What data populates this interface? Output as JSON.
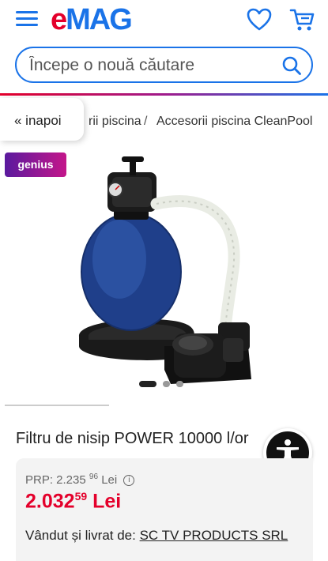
{
  "header": {
    "logo_e": "e",
    "logo_mag": "MAG",
    "search": {
      "placeholder": "Începe o nouă căutare"
    }
  },
  "breadcrumb": {
    "back_label": "« inapoi",
    "item1": "rii piscina",
    "separator": "/",
    "item2": "Accesorii piscina CleanPool"
  },
  "badge": {
    "genius": "genius"
  },
  "gallery": {
    "image_count": 3,
    "active_index": 0
  },
  "product": {
    "title": "Filtru de nisip POWER 10000 l/or",
    "prp_label": "PRP: 2.235",
    "prp_cents": "96",
    "prp_currency": "Lei",
    "price_main": "2.032",
    "price_cents": "59",
    "price_currency": "Lei",
    "seller_label": "Vândut și livrat de:",
    "seller_name": "SC TV PRODUCTS SRL"
  },
  "colors": {
    "brand_blue": "#1a73e8",
    "brand_red": "#e4002b",
    "price_red": "#e4002b"
  }
}
